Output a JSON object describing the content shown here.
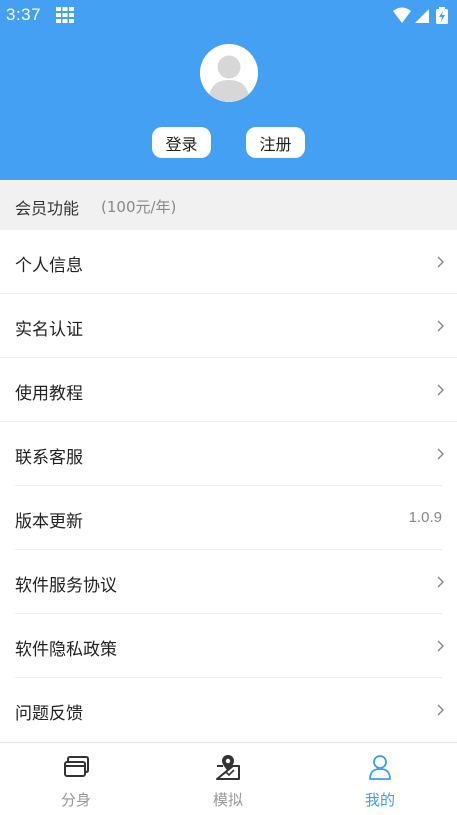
{
  "status_bar": {
    "time": "3:37"
  },
  "auth": {
    "login_label": "登录",
    "register_label": "注册"
  },
  "member": {
    "title": "会员功能",
    "price": "(100元/年)"
  },
  "menu": [
    {
      "label": "个人信息"
    },
    {
      "label": "实名认证"
    },
    {
      "label": "使用教程"
    },
    {
      "label": "联系客服"
    },
    {
      "label": "版本更新",
      "value": "1.0.9"
    },
    {
      "label": "软件服务协议"
    },
    {
      "label": "软件隐私政策"
    },
    {
      "label": "问题反馈"
    }
  ],
  "bottom_nav": [
    {
      "label": "分身",
      "icon": "clone-icon",
      "active": false
    },
    {
      "label": "模拟",
      "icon": "location-pin-icon",
      "active": false
    },
    {
      "label": "我的",
      "icon": "user-icon",
      "active": true
    }
  ],
  "colors": {
    "header": "#44a0f2",
    "active": "#3d9df0",
    "member_bg": "#f1f1f1"
  }
}
